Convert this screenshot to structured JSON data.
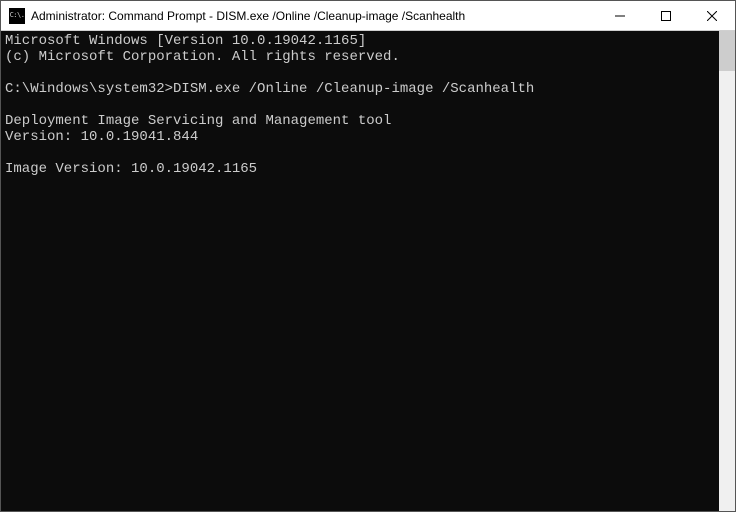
{
  "titlebar": {
    "icon_glyph": "C:\\.",
    "title": "Administrator: Command Prompt - DISM.exe  /Online /Cleanup-image /Scanhealth"
  },
  "console": {
    "lines": [
      "Microsoft Windows [Version 10.0.19042.1165]",
      "(c) Microsoft Corporation. All rights reserved.",
      "",
      "C:\\Windows\\system32>DISM.exe /Online /Cleanup-image /Scanhealth",
      "",
      "Deployment Image Servicing and Management tool",
      "Version: 10.0.19041.844",
      "",
      "Image Version: 10.0.19042.1165",
      ""
    ]
  }
}
